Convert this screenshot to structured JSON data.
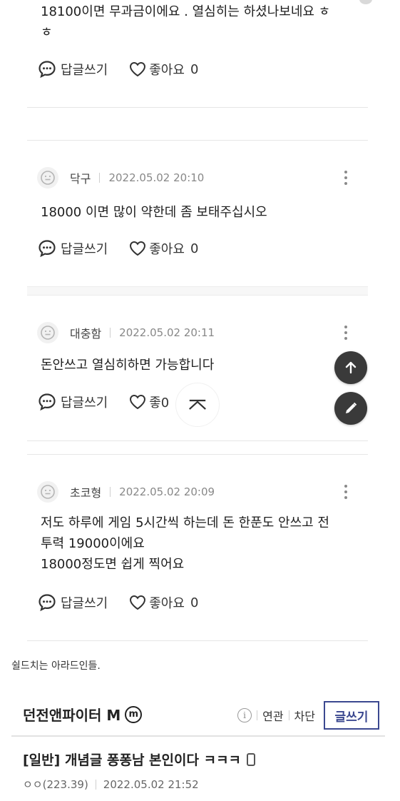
{
  "prev_comment": {
    "text_line1": "18100이면 무과금이에요 . 열심히는 하셨나보네요 ㅎ",
    "text_line2": "ㅎ"
  },
  "actions": {
    "reply_label": "답글쓰기",
    "like_label": "좋아요",
    "like_count": "0",
    "like_label_truncated": "좋0"
  },
  "comments": [
    {
      "author": "닥구",
      "date": "2022.05.02 20:10",
      "lines": [
        "18000 이면 많이 약한데 좀  보태주십시오"
      ]
    },
    {
      "author": "대충함",
      "date": "2022.05.02 20:11",
      "lines": [
        "돈안쓰고 열심히하면 가능합니다"
      ]
    },
    {
      "author": "초코형",
      "date": "2022.05.02 20:09",
      "lines": [
        "저도 하루에 게임 5시간씩 하는데 돈 한푼도 안쓰고 전",
        "투력 19000이에요",
        "18000정도면 쉽게 찍어요"
      ]
    }
  ],
  "caption": "쉴드치는 아라드인들.",
  "gallery": {
    "name": "던전앤파이터 M",
    "badge": "m",
    "info_glyph": "i",
    "related": "연관",
    "block": "차단",
    "write": "글쓰기"
  },
  "post": {
    "title": "[일반] 개념글 퐁퐁남 본인이다 ㅋㅋㅋ",
    "author": "ㅇㅇ(223.39)",
    "date": "2022.05.02 21:52"
  },
  "colors": {
    "accent": "#3b4890",
    "fab": "#3a3a3a",
    "divider": "#e6e6e6"
  }
}
